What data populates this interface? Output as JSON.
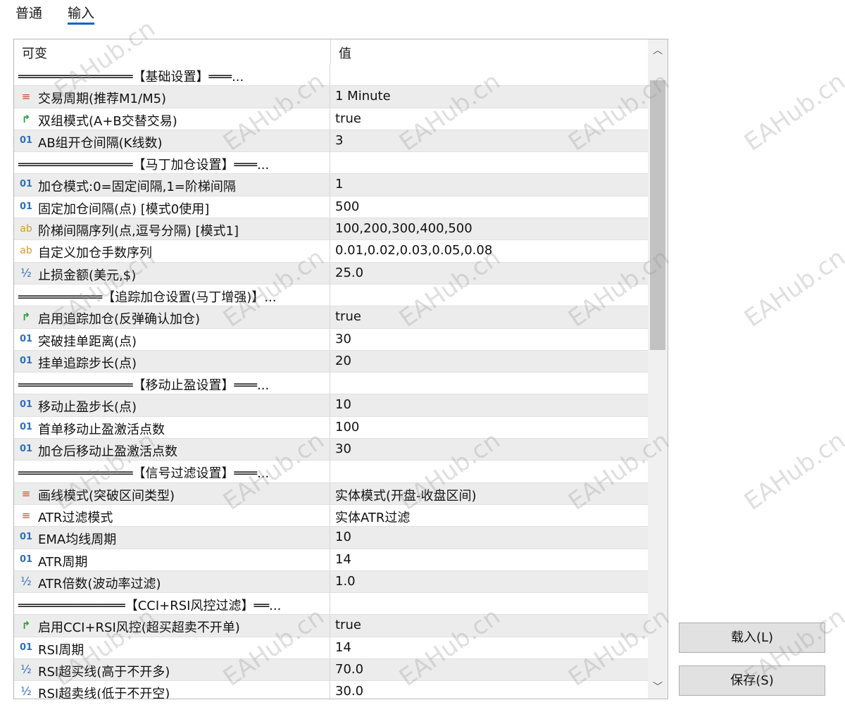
{
  "tabs": [
    {
      "label": "普通"
    },
    {
      "label": "输入"
    }
  ],
  "header": {
    "variable": "可变",
    "value": "值"
  },
  "rows": [
    {
      "type": "sep",
      "name": "═══════════════【基础设置】═══...",
      "value": ""
    },
    {
      "type": "enum",
      "icon": "≡",
      "name": "交易周期(推荐M1/M5)",
      "value": "1 Minute"
    },
    {
      "type": "bool",
      "icon": "↱",
      "name": "双组模式(A+B交替交易)",
      "value": "true"
    },
    {
      "type": "int",
      "icon": "01",
      "name": "AB组开仓间隔(K线数)",
      "value": "3"
    },
    {
      "type": "sep",
      "name": "═══════════════【马丁加仓设置】═══...",
      "value": ""
    },
    {
      "type": "int",
      "icon": "01",
      "name": "加仓模式:0=固定间隔,1=阶梯间隔",
      "value": "1"
    },
    {
      "type": "int",
      "icon": "01",
      "name": "固定加仓间隔(点) [模式0使用]",
      "value": "500"
    },
    {
      "type": "str",
      "icon": "ab",
      "name": "阶梯间隔序列(点,逗号分隔) [模式1]",
      "value": "100,200,300,400,500"
    },
    {
      "type": "str",
      "icon": "ab",
      "name": "自定义加仓手数序列",
      "value": "0.01,0.02,0.03,0.05,0.08"
    },
    {
      "type": "dbl",
      "icon": "½",
      "name": "止损金额(美元,$)",
      "value": "25.0"
    },
    {
      "type": "sep",
      "name": "═══════════【追踪加仓设置(马丁增强)】...",
      "value": ""
    },
    {
      "type": "bool",
      "icon": "↱",
      "name": "启用追踪加仓(反弹确认加仓)",
      "value": "true"
    },
    {
      "type": "int",
      "icon": "01",
      "name": "突破挂单距离(点)",
      "value": "30"
    },
    {
      "type": "int",
      "icon": "01",
      "name": "挂单追踪步长(点)",
      "value": "20"
    },
    {
      "type": "sep",
      "name": "═══════════════【移动止盈设置】═══...",
      "value": ""
    },
    {
      "type": "int",
      "icon": "01",
      "name": "移动止盈步长(点)",
      "value": "10"
    },
    {
      "type": "int",
      "icon": "01",
      "name": "首单移动止盈激活点数",
      "value": "100"
    },
    {
      "type": "int",
      "icon": "01",
      "name": "加仓后移动止盈激活点数",
      "value": "30"
    },
    {
      "type": "sep",
      "name": "═══════════════【信号过滤设置】═══...",
      "value": ""
    },
    {
      "type": "enum",
      "icon": "≡",
      "name": "画线模式(突破区间类型)",
      "value": "实体模式(开盘-收盘区间)"
    },
    {
      "type": "enum",
      "icon": "≡",
      "name": "ATR过滤模式",
      "value": "实体ATR过滤"
    },
    {
      "type": "int",
      "icon": "01",
      "name": "EMA均线周期",
      "value": "10"
    },
    {
      "type": "int",
      "icon": "01",
      "name": "ATR周期",
      "value": "14"
    },
    {
      "type": "dbl",
      "icon": "½",
      "name": "ATR倍数(波动率过滤)",
      "value": "1.0"
    },
    {
      "type": "sep",
      "name": "══════════════【CCI+RSI风控过滤】══...",
      "value": ""
    },
    {
      "type": "bool",
      "icon": "↱",
      "name": "启用CCI+RSI风控(超买超卖不开单)",
      "value": "true"
    },
    {
      "type": "int",
      "icon": "01",
      "name": "RSI周期",
      "value": "14"
    },
    {
      "type": "dbl",
      "icon": "½",
      "name": "RSI超买线(高于不开多)",
      "value": "70.0"
    },
    {
      "type": "dbl",
      "icon": "½",
      "name": "RSI超卖线(低于不开空)",
      "value": "30.0"
    }
  ],
  "buttons": {
    "load": "载入(L)",
    "save": "保存(S)"
  },
  "watermark": "EAHub.cn",
  "scrollbar": {
    "up": "︿",
    "down": "﹀"
  }
}
